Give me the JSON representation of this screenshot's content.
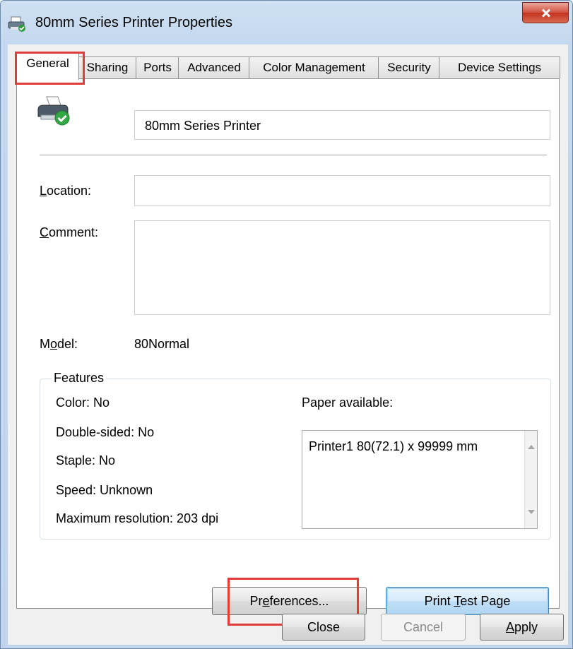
{
  "window": {
    "title": "80mm Series Printer Properties"
  },
  "tabs": [
    {
      "label": "General",
      "active": true
    },
    {
      "label": "Sharing"
    },
    {
      "label": "Ports"
    },
    {
      "label": "Advanced"
    },
    {
      "label": "Color Management"
    },
    {
      "label": "Security"
    },
    {
      "label": "Device Settings"
    }
  ],
  "general": {
    "printer_name": "80mm Series Printer",
    "location_label": {
      "prefix": "",
      "accel": "L",
      "rest": "ocation:"
    },
    "location_value": "",
    "comment_label": {
      "prefix": "",
      "accel": "C",
      "rest": "omment:"
    },
    "comment_value": "",
    "model_label": {
      "prefix": "M",
      "accel": "o",
      "rest": "del:"
    },
    "model_value": "80Normal"
  },
  "features": {
    "group_label": "Features",
    "color": "Color: No",
    "double_sided": "Double-sided: No",
    "staple": "Staple: No",
    "speed": "Speed: Unknown",
    "max_resolution": "Maximum resolution: 203 dpi",
    "paper_label": "Paper available:",
    "paper_items": [
      "Printer1 80(72.1) x 99999 mm"
    ]
  },
  "buttons": {
    "preferences": {
      "prefix": "Pr",
      "accel": "e",
      "rest": "ferences..."
    },
    "print_test": {
      "prefix": "Print ",
      "accel": "T",
      "rest": "est Page"
    },
    "close": "Close",
    "cancel": "Cancel",
    "apply": {
      "prefix": "",
      "accel": "A",
      "rest": "pply"
    }
  },
  "colors": {
    "highlight": "#e23b3b",
    "accent": "#3c7fb1"
  }
}
